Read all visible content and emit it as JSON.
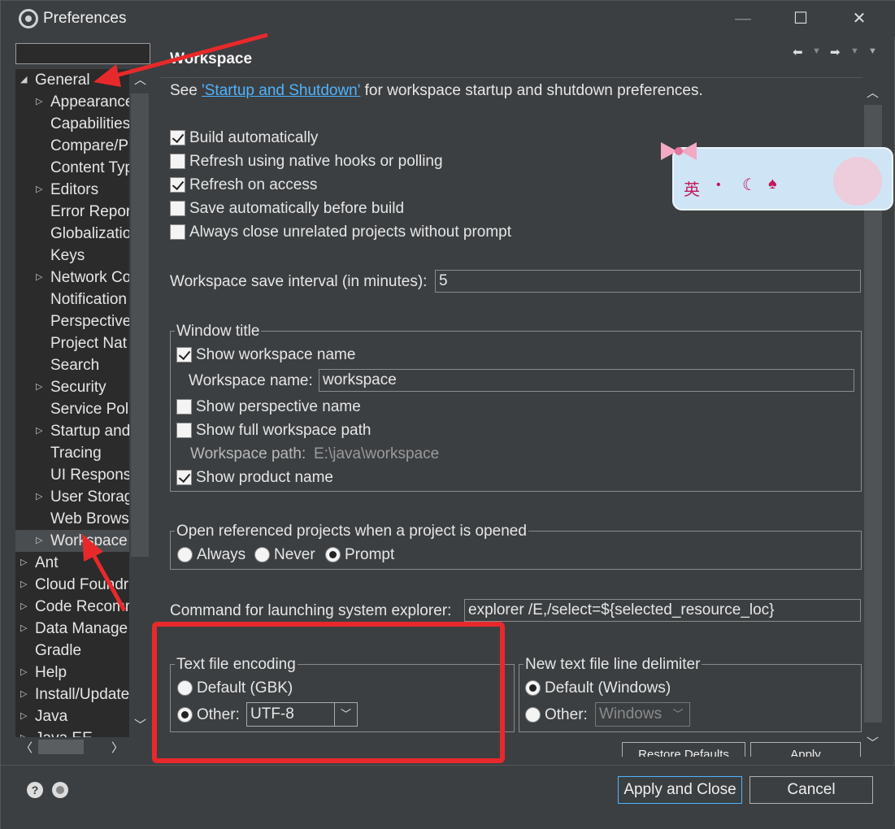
{
  "window": {
    "title": "Preferences"
  },
  "tree": {
    "filter_placeholder": "",
    "items": [
      {
        "label": "General",
        "level": 0,
        "expanded": true
      },
      {
        "label": "Appearance",
        "level": 1,
        "collapsed": true
      },
      {
        "label": "Capabilities",
        "level": 1
      },
      {
        "label": "Compare/P",
        "level": 1
      },
      {
        "label": "Content Typ",
        "level": 1
      },
      {
        "label": "Editors",
        "level": 1,
        "collapsed": true
      },
      {
        "label": "Error Repor",
        "level": 1
      },
      {
        "label": "Globalizatio",
        "level": 1
      },
      {
        "label": "Keys",
        "level": 1
      },
      {
        "label": "Network Co",
        "level": 1,
        "collapsed": true
      },
      {
        "label": "Notification",
        "level": 1
      },
      {
        "label": "Perspective",
        "level": 1
      },
      {
        "label": "Project Nat",
        "level": 1
      },
      {
        "label": "Search",
        "level": 1
      },
      {
        "label": "Security",
        "level": 1,
        "collapsed": true
      },
      {
        "label": "Service Poli",
        "level": 1
      },
      {
        "label": "Startup and",
        "level": 1,
        "collapsed": true
      },
      {
        "label": "Tracing",
        "level": 1
      },
      {
        "label": "UI Responsi",
        "level": 1
      },
      {
        "label": "User Storag",
        "level": 1,
        "collapsed": true
      },
      {
        "label": "Web Brows",
        "level": 1
      },
      {
        "label": "Workspace",
        "level": 1,
        "collapsed": true,
        "selected": true
      },
      {
        "label": "Ant",
        "level": 0,
        "collapsed": true
      },
      {
        "label": "Cloud Foundr",
        "level": 0,
        "collapsed": true
      },
      {
        "label": "Code Recomm",
        "level": 0,
        "collapsed": true
      },
      {
        "label": "Data Manage",
        "level": 0,
        "collapsed": true
      },
      {
        "label": "Gradle",
        "level": 0
      },
      {
        "label": "Help",
        "level": 0,
        "collapsed": true
      },
      {
        "label": "Install/Update",
        "level": 0,
        "collapsed": true
      },
      {
        "label": "Java",
        "level": 0,
        "collapsed": true
      },
      {
        "label": "Java EE",
        "level": 0,
        "collapsed": true
      }
    ]
  },
  "page": {
    "title": "Workspace",
    "intro_prefix": "See ",
    "intro_link": "'Startup and Shutdown'",
    "intro_suffix": " for workspace startup and shutdown preferences.",
    "checkboxes": [
      {
        "label": "Build automatically",
        "checked": true
      },
      {
        "label": "Refresh using native hooks or polling",
        "checked": false
      },
      {
        "label": "Refresh on access",
        "checked": true
      },
      {
        "label": "Save automatically before build",
        "checked": false
      },
      {
        "label": "Always close unrelated projects without prompt",
        "checked": false
      }
    ],
    "save_interval_label": "Workspace save interval (in minutes):",
    "save_interval_value": "5",
    "window_title": {
      "group_label": "Window title",
      "show_workspace_name": "Show workspace name",
      "workspace_name_label": "Workspace name:",
      "workspace_name_value": "workspace",
      "show_perspective_name": "Show perspective name",
      "show_full_path": "Show full workspace path",
      "workspace_path_label": "Workspace path:",
      "workspace_path_value": "E:\\java\\workspace",
      "show_product_name": "Show product name"
    },
    "open_referenced": {
      "group_label": "Open referenced projects when a project is opened",
      "options": [
        "Always",
        "Never",
        "Prompt"
      ],
      "selected": "Prompt"
    },
    "explorer_label": "Command for launching system explorer:",
    "explorer_value": "explorer /E,/select=${selected_resource_loc}",
    "encoding": {
      "group_label": "Text file encoding",
      "default_label": "Default (GBK)",
      "other_label": "Other:",
      "other_value": "UTF-8",
      "selected": "Other"
    },
    "line_delimiter": {
      "group_label": "New text file line delimiter",
      "default_label": "Default (Windows)",
      "other_label": "Other:",
      "other_value": "Windows",
      "selected": "Default"
    },
    "restore_defaults": "Restore Defaults",
    "apply": "Apply"
  },
  "buttons": {
    "apply_close": "Apply and Close",
    "cancel": "Cancel"
  },
  "ime_banner_char": "英",
  "colors": {
    "accent": "#4fb3ff",
    "highlight": "#e8292b",
    "background": "#3c3f41"
  }
}
